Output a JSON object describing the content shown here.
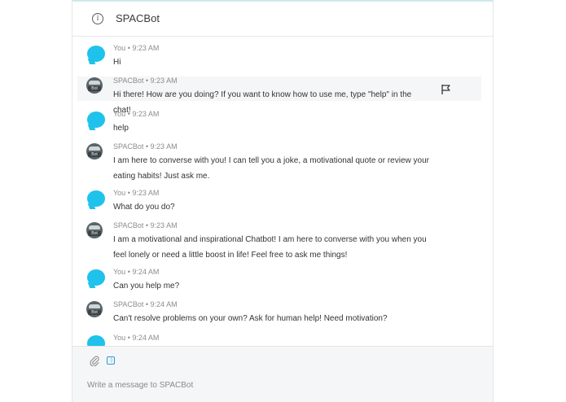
{
  "header": {
    "title": "SPACBot",
    "info_icon": "info-circle-icon"
  },
  "messages": [
    {
      "author": "You",
      "time": "9:23 AM",
      "lines": [
        "Hi"
      ]
    },
    {
      "author": "SPACBot",
      "time": "9:23 AM",
      "lines": [
        "Hi there! How are you doing? If you want to know how to use me, type \"help\" in the chat!"
      ],
      "flag_icon": "flag-icon"
    },
    {
      "author": "You",
      "time": "9:23 AM",
      "lines": [
        "help"
      ]
    },
    {
      "author": "SPACBot",
      "time": "9:23 AM",
      "lines": [
        "I am here to converse with you! I can tell you a joke, a motivational quote or review your",
        "eating habits! Just ask me."
      ]
    },
    {
      "author": "You",
      "time": "9:23 AM",
      "lines": [
        "What do you do?"
      ]
    },
    {
      "author": "SPACBot",
      "time": "9:23 AM",
      "lines": [
        "I am a motivational and inspirational Chatbot! I am here to converse with you when you",
        "feel lonely or need a little boost in life! Feel free to ask me things!"
      ]
    },
    {
      "author": "You",
      "time": "9:24 AM",
      "lines": [
        "Can you help me?"
      ]
    },
    {
      "author": "SPACBot",
      "time": "9:24 AM",
      "lines": [
        "Can't resolve problems on your own? Ask for human help! Need motivation?"
      ]
    },
    {
      "author": "You",
      "time": "9:24 AM",
      "lines": []
    }
  ],
  "avatars": {
    "user": "chat-bubble-avatar-icon",
    "bot_label": "Bot"
  },
  "meta_separator": "•",
  "scroll_icon": "chevron-down-icon",
  "composer": {
    "placeholder": "Write a message to SPACBot",
    "attach_icon": "paperclip-icon",
    "emoji_icon": "emoji-icon"
  },
  "colors": {
    "accent": "#1fc2ea",
    "bot_avatar": "#5a6469",
    "highlight_row": "#f5f6f7"
  }
}
